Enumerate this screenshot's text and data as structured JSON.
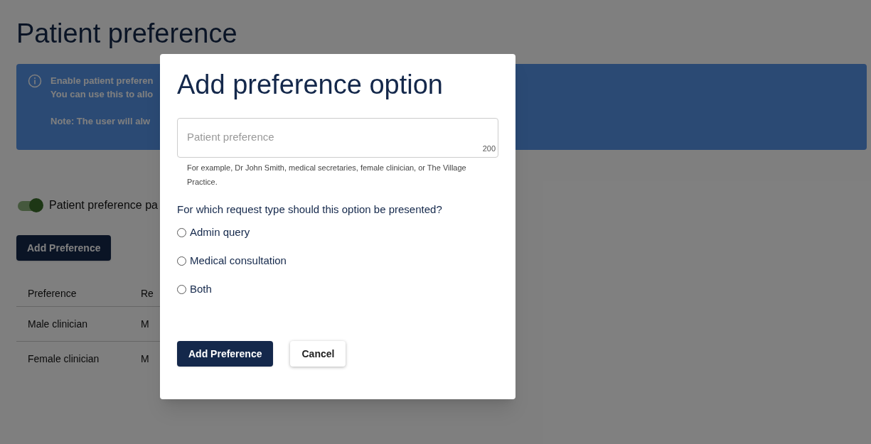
{
  "page": {
    "title": "Patient preference",
    "info_banner": {
      "lines": [
        "Enable patient preferen",
        "You can use this to allo",
        "Note: The user will alw"
      ]
    },
    "toggle": {
      "label": "Patient preference pa",
      "on": true
    },
    "add_button": "Add Preference",
    "table": {
      "columns": [
        "Preference",
        "Re"
      ],
      "rows": [
        [
          "Male clinician",
          "M"
        ],
        [
          "Female clinician",
          "M"
        ]
      ]
    }
  },
  "dialog": {
    "title": "Add preference option",
    "field": {
      "placeholder": "Patient preference",
      "counter": "200",
      "hint": "For example, Dr John Smith, medical secretaries, female clinician, or The Village Practice."
    },
    "question": "For which request type should this option be presented?",
    "options": [
      {
        "label": "Admin query",
        "selected": false
      },
      {
        "label": "Medical consultation",
        "selected": false
      },
      {
        "label": "Both",
        "selected": false
      }
    ],
    "buttons": [
      {
        "label": "Add Preference",
        "kind": "primary"
      },
      {
        "label": "Cancel",
        "kind": "secondary"
      }
    ]
  }
}
